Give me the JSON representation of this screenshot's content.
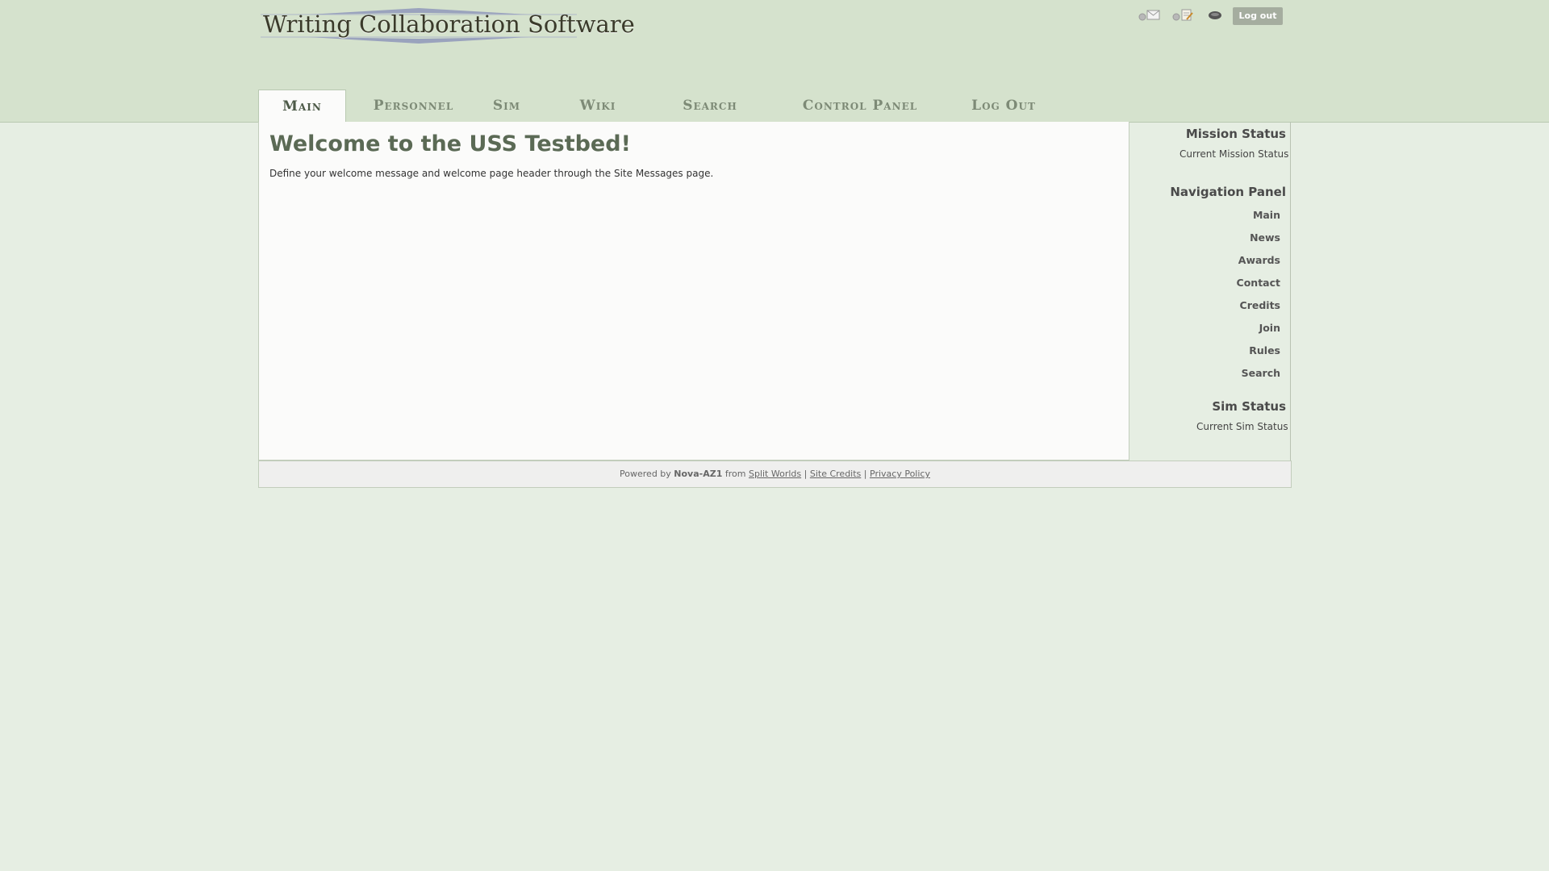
{
  "header": {
    "logo_text": "Writing Collaboration Software",
    "logout_label": "Log out",
    "icons": [
      "mail-icon",
      "notes-icon",
      "user-status-icon"
    ]
  },
  "tabs": [
    {
      "label": "Main",
      "active": true
    },
    {
      "label": "Personnel",
      "active": false
    },
    {
      "label": "Sim",
      "active": false
    },
    {
      "label": "Wiki",
      "active": false
    },
    {
      "label": "Search",
      "active": false
    },
    {
      "label": "Control Panel",
      "active": false
    },
    {
      "label": "Log Out",
      "active": false
    }
  ],
  "main": {
    "title": "Welcome to the USS Testbed!",
    "description": "Define your welcome message and welcome page header through the Site Messages page."
  },
  "sidebar": {
    "mission_status": {
      "heading": "Mission Status",
      "text": "Current Mission Status"
    },
    "navigation": {
      "heading": "Navigation Panel",
      "items": [
        "Main",
        "News",
        "Awards",
        "Contact",
        "Credits",
        "Join",
        "Rules",
        "Search"
      ]
    },
    "sim_status": {
      "heading": "Sim Status",
      "text": "Current Sim Status"
    }
  },
  "footer": {
    "powered_prefix": "Powered by",
    "product": "Nova-AZ1",
    "from": "from",
    "split_worlds": "Split Worlds",
    "sep1": "|",
    "site_credits": "Site Credits",
    "sep2": "|",
    "privacy_policy": "Privacy Policy"
  },
  "colors": {
    "header_bg": "#d5e2cd",
    "page_bg": "#e6eee3",
    "title": "#5b6a55",
    "button": "#a5ad9f"
  }
}
